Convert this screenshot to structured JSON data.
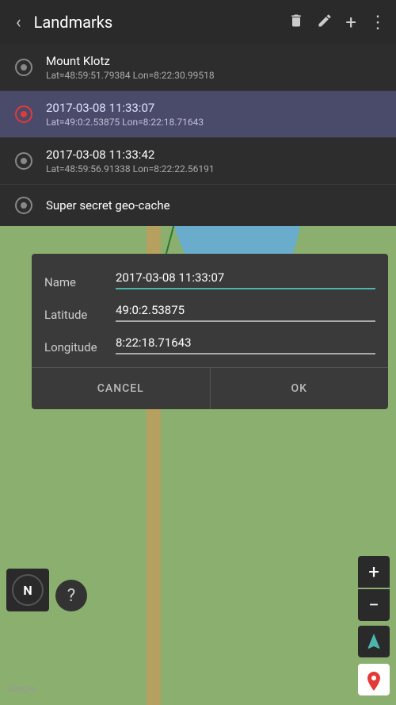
{
  "topbar": {
    "title": "Landmarks",
    "back_icon": "‹",
    "delete_icon": "🗑",
    "edit_icon": "✏",
    "add_icon": "+",
    "more_icon": "⋮"
  },
  "landmarks": [
    {
      "id": 0,
      "name": "Mount Klotz",
      "coords": "Lat=48:59:51.79384 Lon=8:22:30.99518",
      "active": false,
      "icon_type": "grey"
    },
    {
      "id": 1,
      "name": "2017-03-08 11:33:07",
      "coords": "Lat=49:0:2.53875 Lon=8:22:18.71643",
      "active": true,
      "icon_type": "red"
    },
    {
      "id": 2,
      "name": "2017-03-08 11:33:42",
      "coords": "Lat=48:59:56.91338 Lon=8:22:22.56191",
      "active": false,
      "icon_type": "grey"
    },
    {
      "id": 3,
      "name": "Super secret geo-cache",
      "coords": "",
      "active": false,
      "icon_type": "grey"
    }
  ],
  "dialog": {
    "name_label": "Name",
    "name_value": "2017-03-08 11:33:07",
    "latitude_label": "Latitude",
    "latitude_value": "49:0:2.53875",
    "longitude_label": "Longitude",
    "longitude_value": "8:22:18.71643",
    "cancel_label": "CANCEL",
    "ok_label": "OK"
  },
  "map": {
    "google_label": "Google",
    "zoom_plus": "+",
    "zoom_minus": "−",
    "compass_letter": "N"
  }
}
